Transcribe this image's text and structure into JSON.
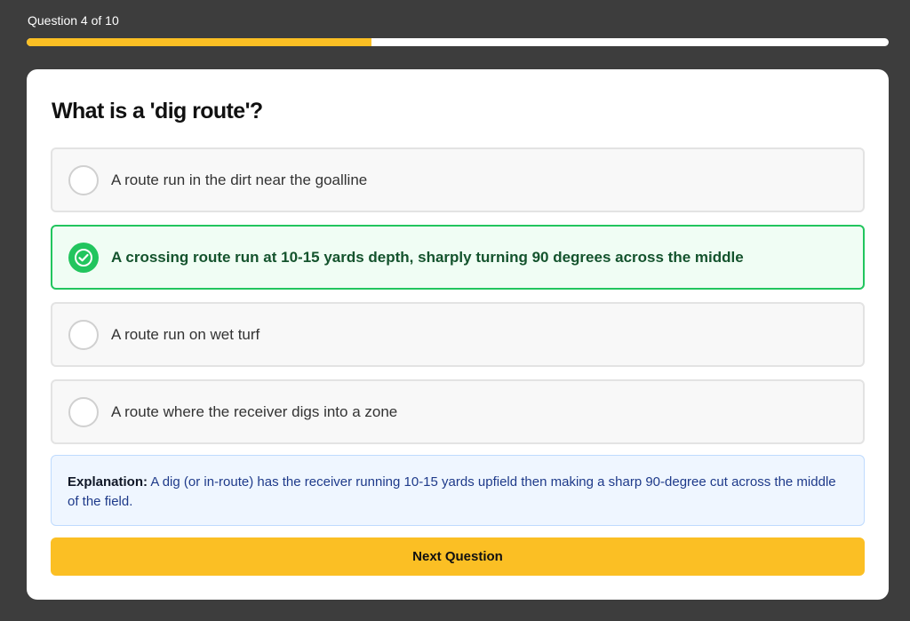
{
  "progress": {
    "label": "Question 4 of 10",
    "fraction": 0.4,
    "fill_color": "#fbbf24"
  },
  "question": {
    "text": "What is a 'dig route'?"
  },
  "options": [
    {
      "label": "A route run in the dirt near the goalline",
      "state": "unselected"
    },
    {
      "label": "A crossing route run at 10-15 yards depth, sharply turning 90 degrees across the middle",
      "state": "correct",
      "icon": "check-circle-icon"
    },
    {
      "label": "A route run on wet turf",
      "state": "unselected"
    },
    {
      "label": "A route where the receiver digs into a zone",
      "state": "unselected"
    }
  ],
  "explanation": {
    "heading": "Explanation:",
    "text": "A dig (or in-route) has the receiver running 10-15 yards upfield then making a sharp 90-degree cut across the middle of the field."
  },
  "next_button": {
    "label": "Next Question"
  },
  "colors": {
    "accent": "#fbbf24",
    "correct": "#22c55e",
    "background": "#3d3d3d"
  }
}
